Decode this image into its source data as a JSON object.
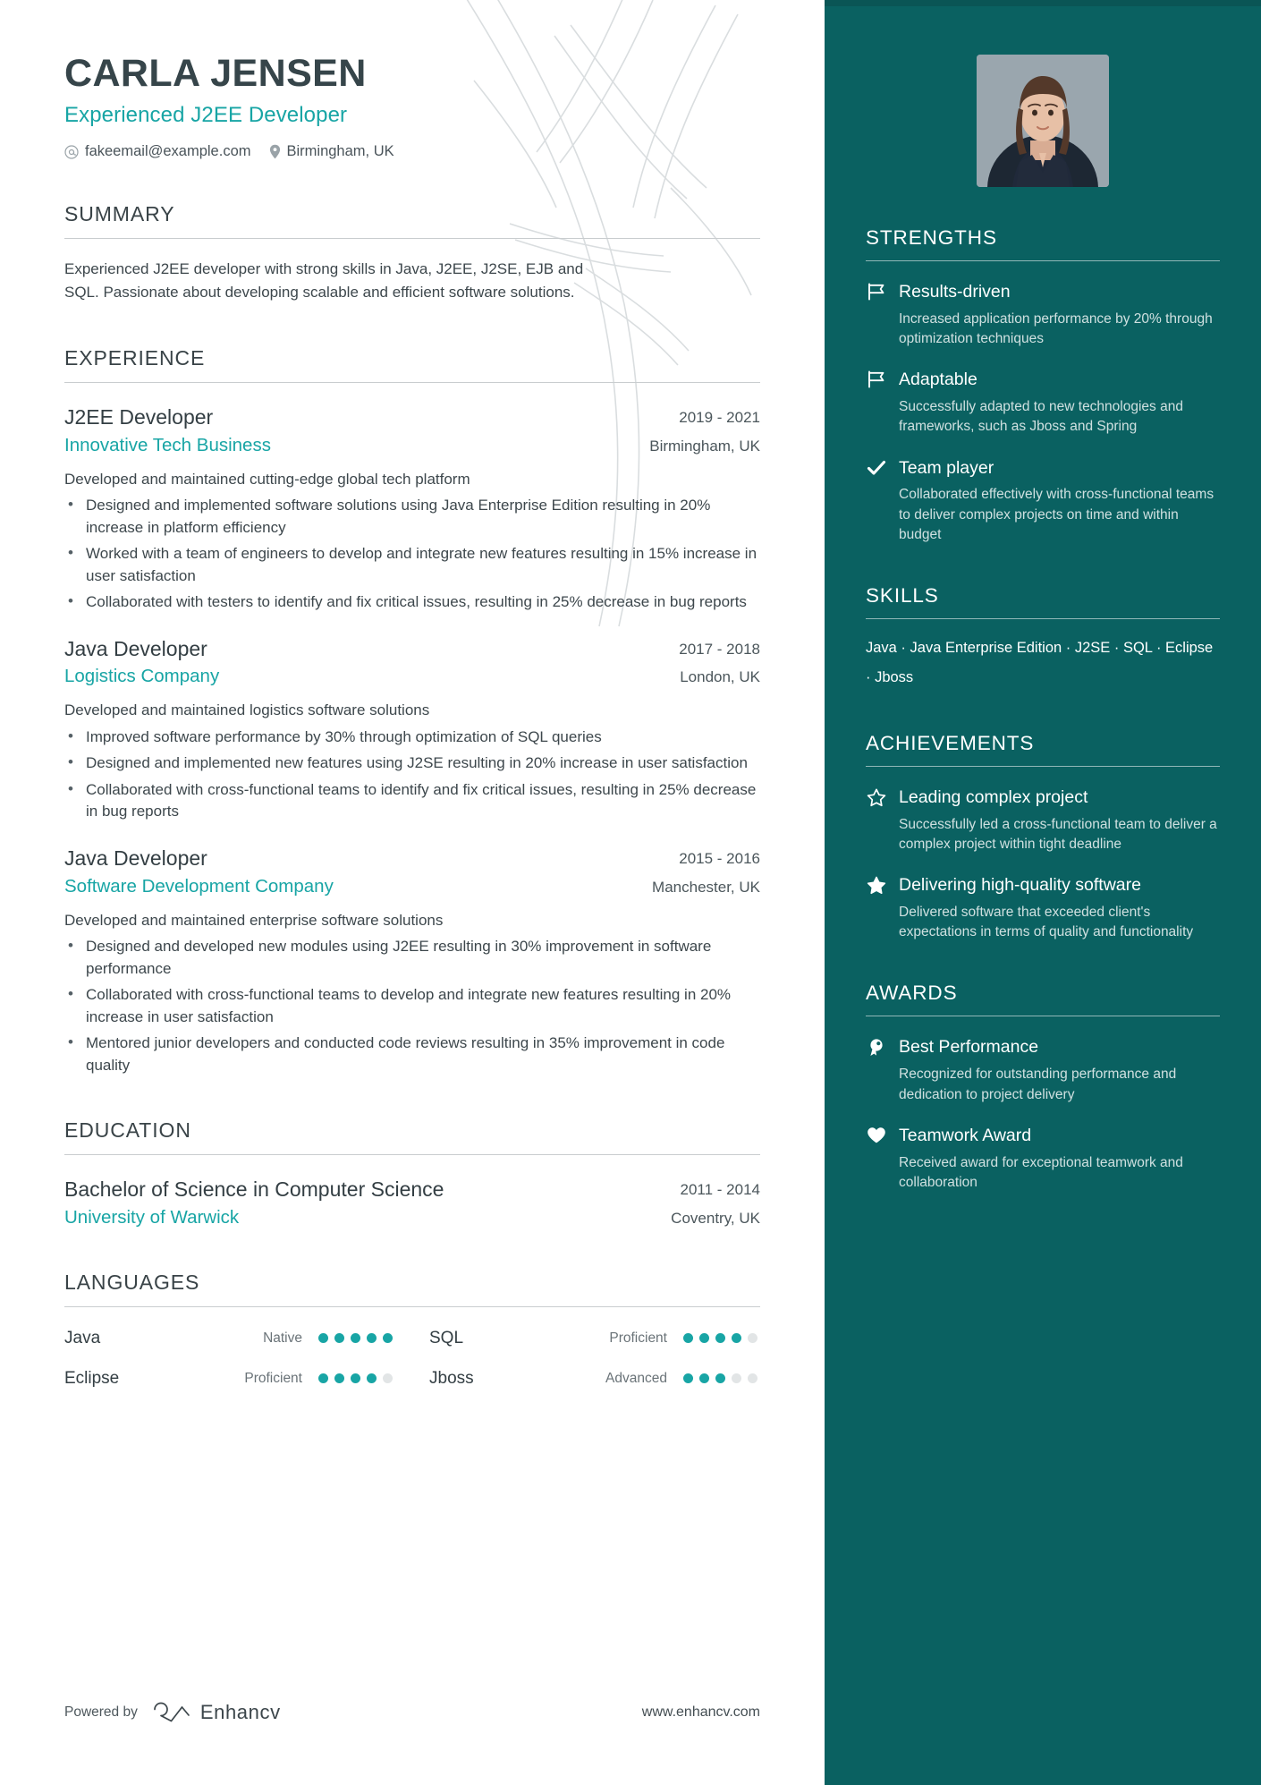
{
  "header": {
    "name": "CARLA JENSEN",
    "headline": "Experienced J2EE Developer",
    "email": "fakeemail@example.com",
    "location": "Birmingham, UK"
  },
  "summary": {
    "title": "SUMMARY",
    "text": "Experienced J2EE developer with strong skills in Java, J2EE, J2SE, EJB and SQL. Passionate about developing scalable and efficient software solutions."
  },
  "experience": {
    "title": "EXPERIENCE",
    "entries": [
      {
        "role": "J2EE Developer",
        "dates": "2019 - 2021",
        "company": "Innovative Tech Business",
        "location": "Birmingham, UK",
        "description": "Developed and maintained cutting-edge global tech platform",
        "bullets": [
          "Designed and implemented software solutions using Java Enterprise Edition resulting in 20% increase in platform efficiency",
          "Worked with a team of engineers to develop and integrate new features resulting in 15% increase in user satisfaction",
          "Collaborated with testers to identify and fix critical issues, resulting in 25% decrease in bug reports"
        ]
      },
      {
        "role": "Java Developer",
        "dates": "2017 - 2018",
        "company": "Logistics Company",
        "location": "London, UK",
        "description": "Developed and maintained logistics software solutions",
        "bullets": [
          "Improved software performance by 30% through optimization of SQL queries",
          "Designed and implemented new features using J2SE resulting in 20% increase in user satisfaction",
          "Collaborated with cross-functional teams to identify and fix critical issues, resulting in 25% decrease in bug reports"
        ]
      },
      {
        "role": "Java Developer",
        "dates": "2015 - 2016",
        "company": "Software Development Company",
        "location": "Manchester, UK",
        "description": "Developed and maintained enterprise software solutions",
        "bullets": [
          "Designed and developed new modules using J2EE resulting in 30% improvement in software performance",
          "Collaborated with cross-functional teams to develop and integrate new features resulting in 20% increase in user satisfaction",
          "Mentored junior developers and conducted code reviews resulting in 35% improvement in code quality"
        ]
      }
    ]
  },
  "education": {
    "title": "EDUCATION",
    "entries": [
      {
        "degree": "Bachelor of Science in Computer Science",
        "dates": "2011 - 2014",
        "school": "University of Warwick",
        "location": "Coventry, UK"
      }
    ]
  },
  "languages": {
    "title": "LANGUAGES",
    "items": [
      {
        "name": "Java",
        "level": "Native",
        "rating": 5,
        "max": 5
      },
      {
        "name": "SQL",
        "level": "Proficient",
        "rating": 4,
        "max": 5
      },
      {
        "name": "Eclipse",
        "level": "Proficient",
        "rating": 4,
        "max": 5
      },
      {
        "name": "Jboss",
        "level": "Advanced",
        "rating": 3,
        "max": 5
      }
    ]
  },
  "footer": {
    "powered_by": "Powered by",
    "brand": "Enhancv",
    "website": "www.enhancv.com"
  },
  "sidebar": {
    "strengths": {
      "title": "STRENGTHS",
      "items": [
        {
          "icon": "flag-icon",
          "title": "Results-driven",
          "description": "Increased application performance by 20% through optimization techniques"
        },
        {
          "icon": "flag-icon",
          "title": "Adaptable",
          "description": "Successfully adapted to new technologies and frameworks, such as Jboss and Spring"
        },
        {
          "icon": "check-icon",
          "title": "Team player",
          "description": "Collaborated effectively with cross-functional teams to deliver complex projects on time and within budget"
        }
      ]
    },
    "skills": {
      "title": "SKILLS",
      "text": "Java · Java Enterprise Edition · J2SE · SQL · Eclipse · Jboss"
    },
    "achievements": {
      "title": "ACHIEVEMENTS",
      "items": [
        {
          "icon": "star-outline-icon",
          "title": "Leading complex project",
          "description": "Successfully led a cross-functional team to deliver a complex project within tight deadline"
        },
        {
          "icon": "star-filled-icon",
          "title": "Delivering high-quality software",
          "description": "Delivered software that exceeded client's expectations in terms of quality and functionality"
        }
      ]
    },
    "awards": {
      "title": "AWARDS",
      "items": [
        {
          "icon": "medal-icon",
          "title": "Best Performance",
          "description": "Recognized for outstanding performance and dedication to project delivery"
        },
        {
          "icon": "heart-icon",
          "title": "Teamwork Award",
          "description": "Received award for exceptional teamwork and collaboration"
        }
      ]
    }
  },
  "colors": {
    "accent": "#18a5a5",
    "sidebar_bg": "#0a6161",
    "heading": "#36454a"
  }
}
